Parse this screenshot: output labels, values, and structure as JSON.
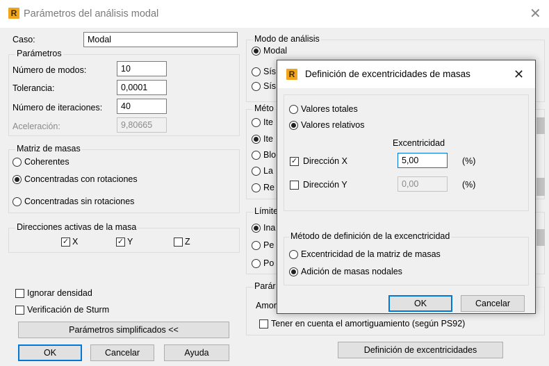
{
  "window": {
    "title": "Parámetros del análisis modal",
    "app_icon": "R"
  },
  "caso": {
    "label": "Caso:",
    "value": "Modal"
  },
  "parametros": {
    "legend": "Parámetros",
    "num_modos": {
      "label": "Número de modos:",
      "value": "10"
    },
    "tolerancia": {
      "label": "Tolerancia:",
      "value": "0,0001"
    },
    "num_iteraciones": {
      "label": "Número de iteraciones:",
      "value": "40"
    },
    "aceleracion": {
      "label": "Aceleración:",
      "value": "9,80665"
    }
  },
  "matriz_masas": {
    "legend": "Matriz de masas",
    "options": [
      "Coherentes",
      "Concentradas con rotaciones",
      "Concentradas sin rotaciones"
    ],
    "selected_index": 1
  },
  "direcciones": {
    "legend": "Direcciones activas de la masa",
    "x": {
      "label": "X",
      "checked": true
    },
    "y": {
      "label": "Y",
      "checked": true
    },
    "z": {
      "label": "Z",
      "checked": false
    }
  },
  "ignorar_densidad": {
    "label": "Ignorar densidad",
    "checked": false
  },
  "verificacion_sturm": {
    "label": "Verificación de Sturm",
    "checked": false
  },
  "simplificados_button": "Parámetros simplificados <<",
  "buttons": {
    "ok": "OK",
    "cancel": "Cancelar",
    "help": "Ayuda"
  },
  "modo_analisis": {
    "legend": "Modo de análisis",
    "options": [
      "Modal",
      "Sís",
      "Sís"
    ],
    "selected_index": 0
  },
  "metodo": {
    "legend": "Méto",
    "options": [
      "Ite",
      "Ite",
      "Blo",
      "La",
      "Re"
    ],
    "selected_index": 1
  },
  "limites": {
    "legend": "Límite",
    "options": [
      "Ina",
      "Pe",
      "Po"
    ],
    "selected_index": 0
  },
  "parametros2": {
    "legend": "Parár",
    "amort_label": "Amor"
  },
  "amortiguamiento": {
    "label": "Tener en cuenta el amortiguamiento (según PS92)",
    "checked": false
  },
  "def_excentricidades_button": "Definición de excentricidades",
  "dialog": {
    "title": "Definición de excentricidades de masas",
    "app_icon": "R",
    "valores": {
      "options": [
        "Valores totales",
        "Valores relativos"
      ],
      "selected_index": 1
    },
    "excentricidad_header": "Excentricidad",
    "dir_x": {
      "label": "Dirección X",
      "checked": true,
      "value": "5,00",
      "unit": "(%)"
    },
    "dir_y": {
      "label": "Dirección Y",
      "checked": false,
      "value": "0,00",
      "unit": "(%)"
    },
    "metodo": {
      "legend": "Método de definición de la excenctricidad",
      "options": [
        "Excentricidad de la matriz de masas",
        "Adición de masas nodales"
      ],
      "selected_index": 1
    },
    "ok": "OK",
    "cancel": "Cancelar"
  }
}
